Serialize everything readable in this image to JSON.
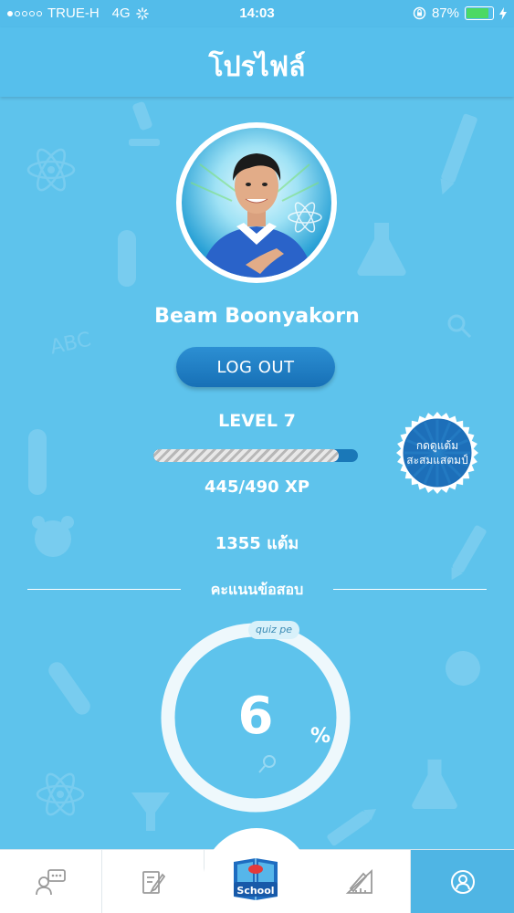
{
  "status_bar": {
    "carrier": "TRUE-H",
    "network": "4G",
    "time": "14:03",
    "battery": "87%",
    "battery_level": 0.87,
    "signal_bars": 1
  },
  "header": {
    "title": "โปรไฟล์"
  },
  "profile": {
    "name": "Beam Boonyakorn",
    "logout_label": "LOG OUT",
    "level": "LEVEL 7",
    "xp_text": "445/490 XP",
    "xp_progress": 0.908,
    "points": "1355  แต้ม"
  },
  "badge": {
    "line1": "กดดูแต้ม",
    "line2": "สะสมแสตมป์"
  },
  "quiz": {
    "section_title": "คะแนนข้อสอบ",
    "tag": "quiz pe",
    "score": "6",
    "percent_sign": "%"
  },
  "tabbar": {
    "tabs": [
      {
        "name": "chat",
        "icon": "chat-person-icon"
      },
      {
        "name": "exam",
        "icon": "edit-paper-icon"
      },
      {
        "name": "school",
        "icon": "school-book-icon",
        "label": "School"
      },
      {
        "name": "ruler",
        "icon": "ruler-pencil-icon"
      },
      {
        "name": "profile",
        "icon": "user-circle-icon"
      }
    ],
    "active_color": "#4fb5e4"
  },
  "colors": {
    "background": "#5ec3ec",
    "header": "#56bfec",
    "button": "#1d7cc0"
  }
}
